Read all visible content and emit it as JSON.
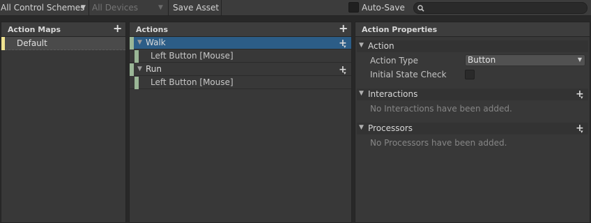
{
  "toolbar": {
    "control_scheme": "All Control Schemes",
    "devices": "All Devices",
    "save_asset": "Save Asset",
    "auto_save": "Auto-Save",
    "search_placeholder": ""
  },
  "action_maps": {
    "title": "Action Maps",
    "items": [
      {
        "label": "Default"
      }
    ]
  },
  "actions": {
    "title": "Actions",
    "items": [
      {
        "label": "Walk",
        "binding": "Left Button [Mouse]"
      },
      {
        "label": "Run",
        "binding": "Left Button [Mouse]"
      }
    ]
  },
  "properties": {
    "title": "Action Properties",
    "action_section": "Action",
    "action_type_label": "Action Type",
    "action_type_value": "Button",
    "initial_state_label": "Initial State Check",
    "interactions_section": "Interactions",
    "interactions_empty": "No Interactions have been added.",
    "processors_section": "Processors",
    "processors_empty": "No Processors have been added."
  },
  "icons": {
    "plus": "+",
    "dropdown_arrow": "▾",
    "foldout_open": "▼"
  },
  "colors": {
    "selection": "#2c5d87",
    "action_map_bar": "#efe391",
    "action_bar": "#9ab696"
  }
}
